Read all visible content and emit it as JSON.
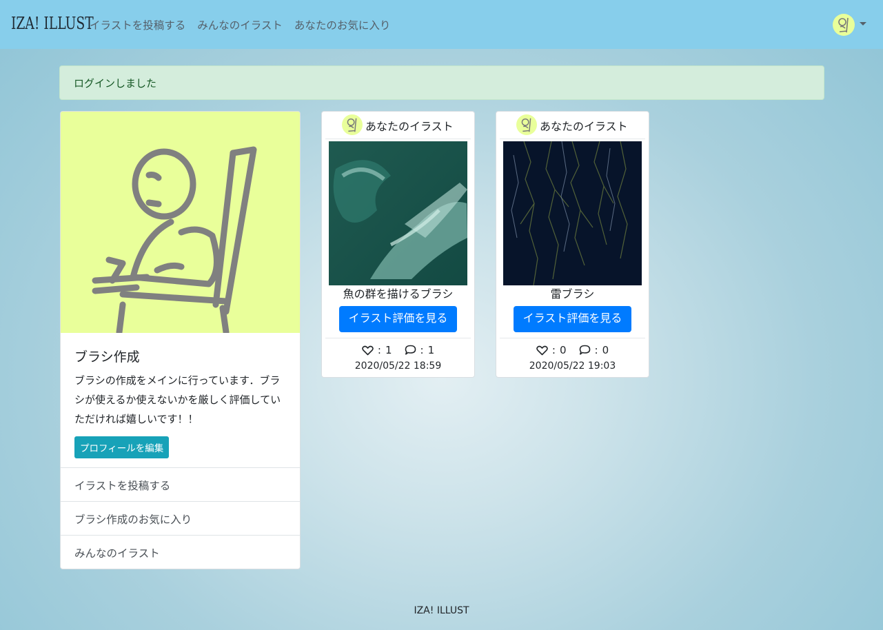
{
  "navbar": {
    "brand": "IZA! ILLUST",
    "links": [
      "イラストを投稿する",
      "みんなのイラスト",
      "あなたのお気に入り"
    ]
  },
  "alert": {
    "message": "ログインしました"
  },
  "profile": {
    "name": "ブラシ作成",
    "description": "ブラシの作成をメインに行っています．ブラシが使えるか使えないかを厳しく評価していただければ嬉しいです！！",
    "edit_label": "プロフィールを編集",
    "menu": [
      "イラストを投稿する",
      "ブラシ作成のお気に入り",
      "みんなのイラスト"
    ]
  },
  "posts": [
    {
      "owner_label": "あなたのイラスト",
      "title": "魚の群を描けるブラシ",
      "button_label": "イラスト評価を見る",
      "likes": "1",
      "comments": "1",
      "date": "2020/05/22 18:59"
    },
    {
      "owner_label": "あなたのイラスト",
      "title": "雷ブラシ",
      "button_label": "イラスト評価を見る",
      "likes": "0",
      "comments": "0",
      "date": "2020/05/22 19:03"
    }
  ],
  "stats": {
    "separator": ": "
  },
  "footer": {
    "text": "IZA! ILLUST"
  },
  "colors": {
    "navbar": "#87ceeb",
    "avatar_bg": "#e9ff9a",
    "primary_button": "#007bff",
    "info_button": "#17a2b8",
    "alert_bg": "#d4eddc",
    "alert_text": "#155724"
  }
}
